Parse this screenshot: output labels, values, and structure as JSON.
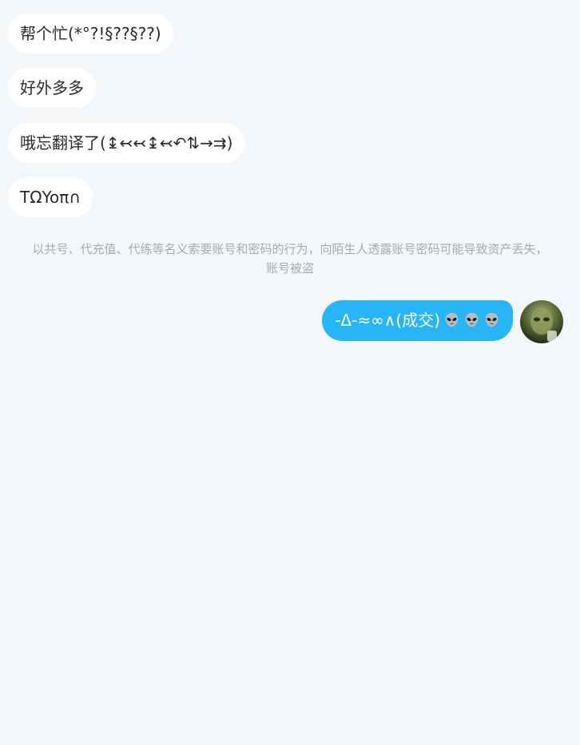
{
  "messages_in": [
    {
      "text": "帮个忙(*°?!§??§??)"
    },
    {
      "text": "好外多多"
    },
    {
      "text": "哦忘翻译了(↨↢↢↨↢↶⇅→⇉)"
    },
    {
      "text": "TΩYoπ∩"
    }
  ],
  "system_notice": {
    "line1": "以共号、代充值、代练等名义索要账号和密码的行为，向陌生人透露账号密码可能导致资产丢失，",
    "line2": "账号被盗"
  },
  "message_out": {
    "text": "-Δ-≈∞∧(成交)",
    "emoji_icons": [
      "alien-emoji",
      "alien-emoji",
      "alien-emoji"
    ],
    "bubble_color": "#26b6f7"
  },
  "avatar": {
    "icon": "alien-photo-avatar"
  }
}
